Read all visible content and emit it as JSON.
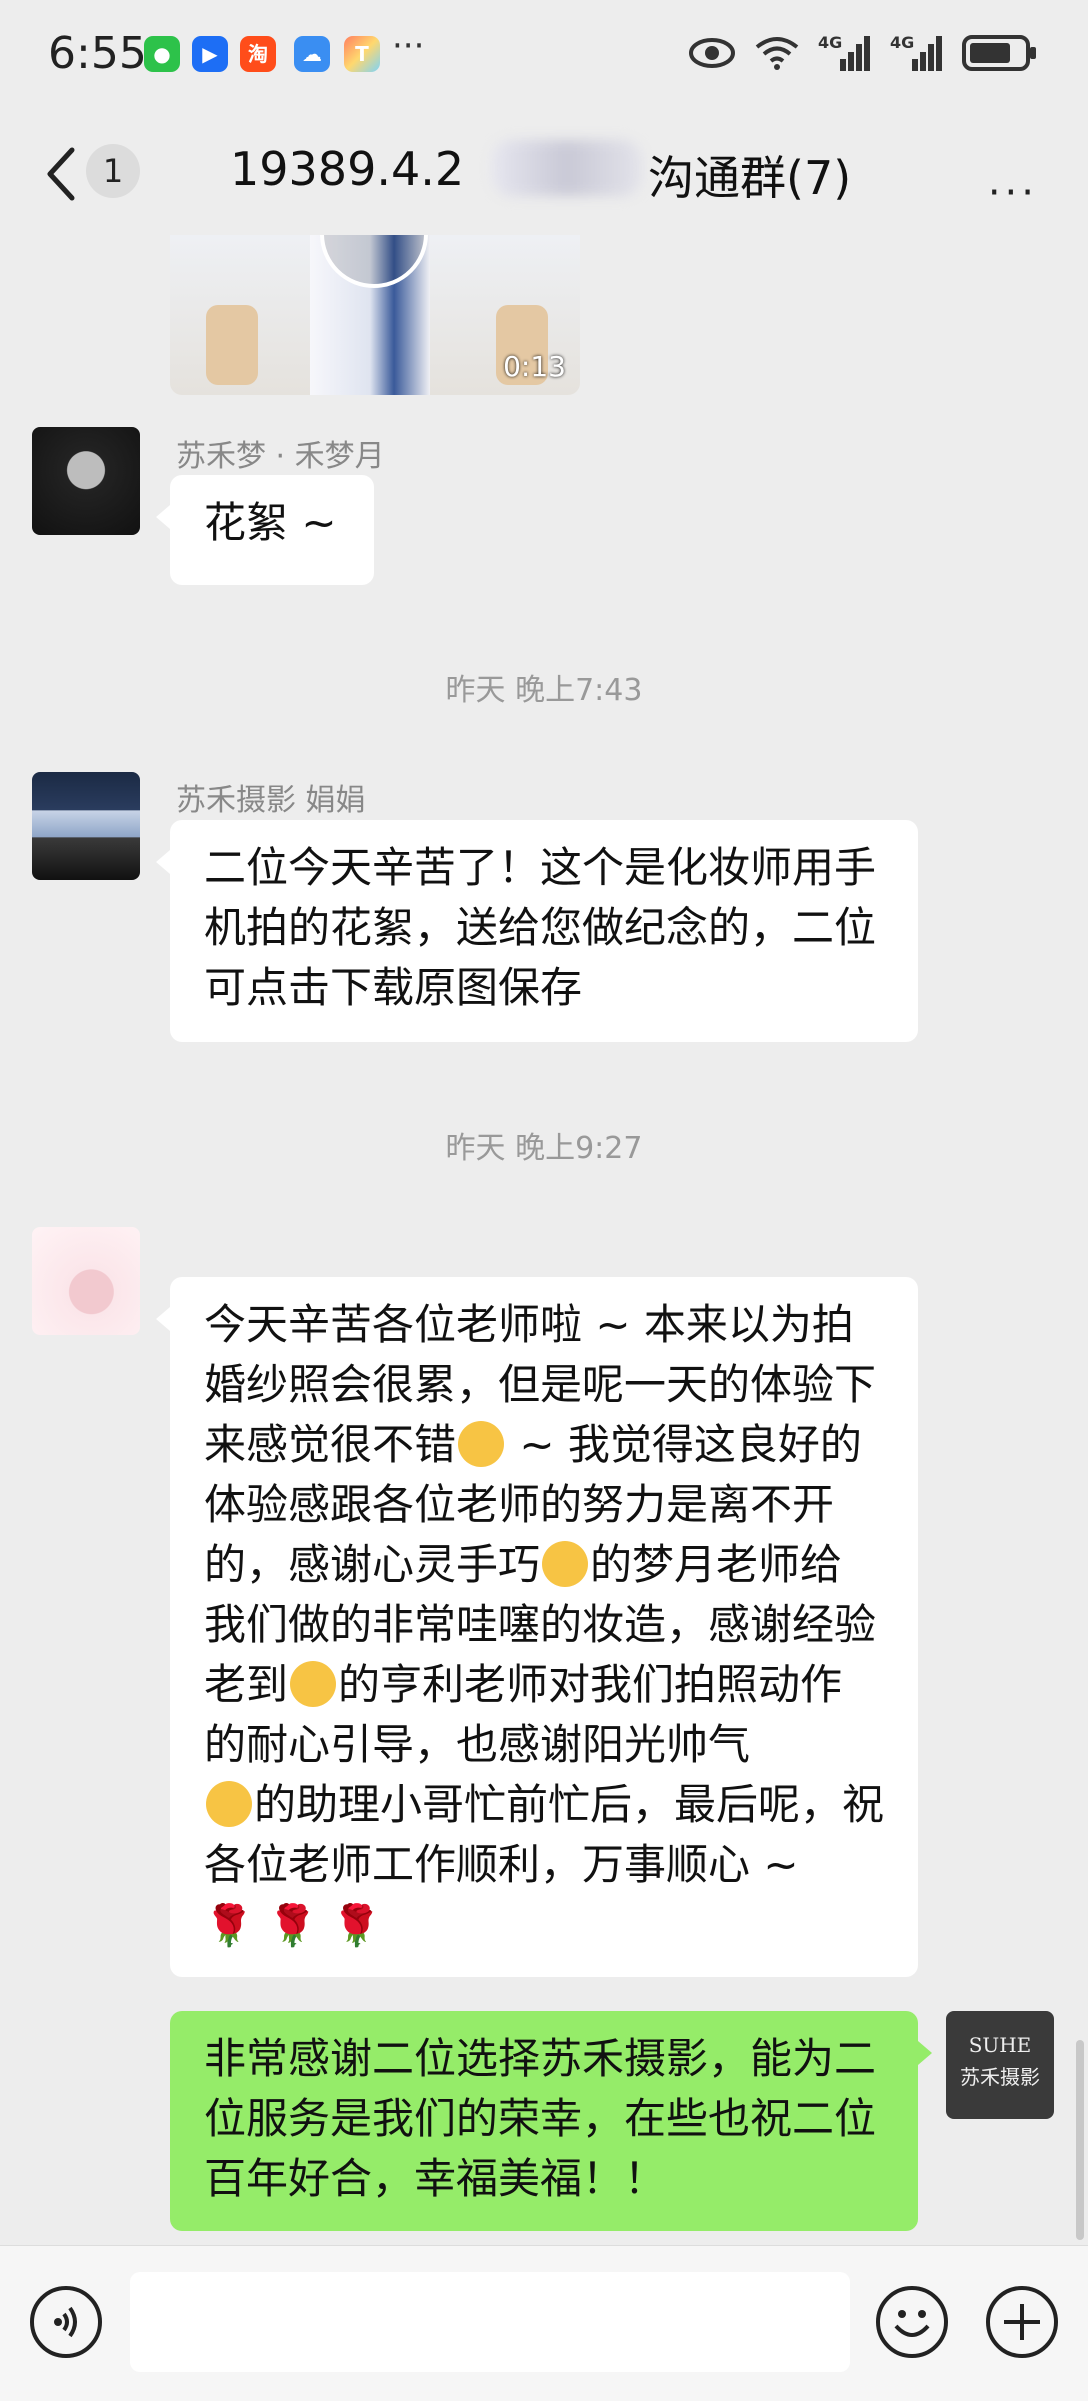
{
  "status_bar": {
    "time": "6:55",
    "network_1": "4G",
    "network_2": "4G"
  },
  "header": {
    "unread_count": "1",
    "title_prefix": "19389.4.2",
    "title_suffix": "沟通群(7)",
    "more_label": "···"
  },
  "video": {
    "duration": "0:13"
  },
  "messages": [
    {
      "sender": "苏禾梦  ·  禾梦月",
      "text": "花絮 ~"
    },
    {
      "sender": "苏禾摄影    娟娟",
      "text": "二位今天辛苦了！这个是化妆师用手机拍的花絮，送给您做纪念的，二位可点击下载原图保存"
    },
    {
      "text_parts": [
        "今天辛苦各位老师啦 ~ 本来以为拍婚纱照会很累，但是呢一天的体验下来感觉很不错",
        " ~ 我觉得这良好的体验感跟各位老师的努力是离不开的，感谢心灵手巧",
        "的梦月老师给我们做的非常哇噻的妆造，感谢经验老到",
        "的亨利老师对我们拍照动作的耐心引导，也感谢阳光帅气",
        "的助理小哥忙前忙后，最后呢，祝各位老师工作顺利，万事顺心 ~"
      ],
      "roses": "🌹"
    },
    {
      "text": "非常感谢二位选择苏禾摄影，能为二位服务是我们的荣幸，在些也祝二位百年好合，幸福美福！！"
    }
  ],
  "timestamps": [
    "昨天 晚上7:43",
    "昨天 晚上9:27"
  ],
  "avatar_logo": {
    "line1": "SUHE",
    "line2": "苏禾摄影"
  },
  "input": {
    "value": "",
    "placeholder": ""
  }
}
